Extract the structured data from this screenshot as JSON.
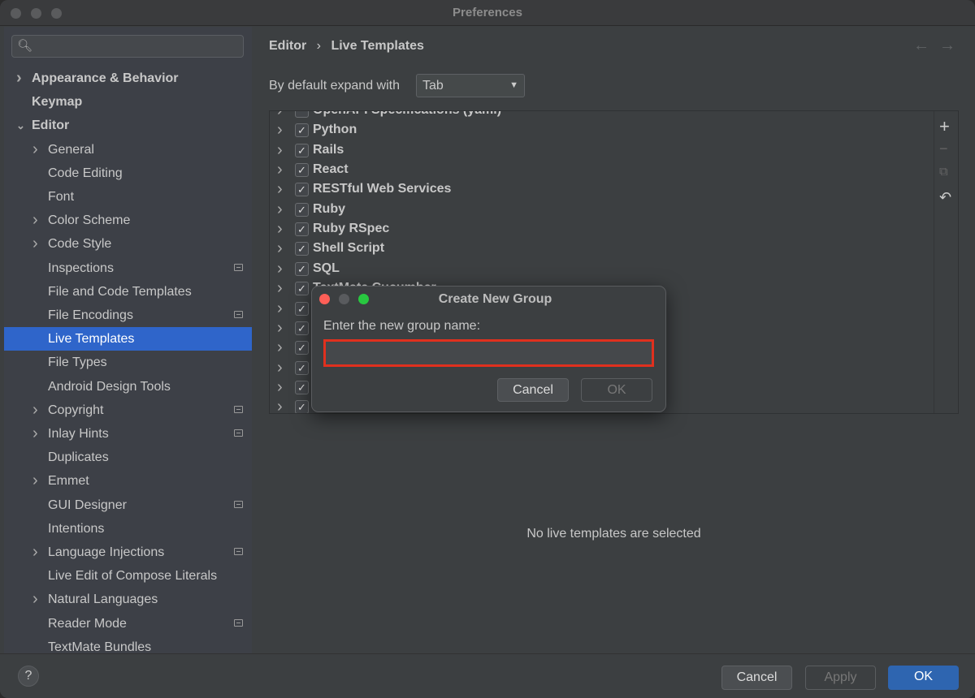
{
  "window": {
    "title": "Preferences"
  },
  "sidebar": {
    "search_placeholder": "",
    "items": [
      {
        "label": "Appearance & Behavior",
        "level": 0,
        "chevron": "right"
      },
      {
        "label": "Keymap",
        "level": 0,
        "chevron": ""
      },
      {
        "label": "Editor",
        "level": 0,
        "chevron": "down"
      },
      {
        "label": "General",
        "level": 1,
        "chevron": "right"
      },
      {
        "label": "Code Editing",
        "level": 1,
        "chevron": ""
      },
      {
        "label": "Font",
        "level": 1,
        "chevron": ""
      },
      {
        "label": "Color Scheme",
        "level": 1,
        "chevron": "right"
      },
      {
        "label": "Code Style",
        "level": 1,
        "chevron": "right"
      },
      {
        "label": "Inspections",
        "level": 1,
        "chevron": "",
        "badge": true
      },
      {
        "label": "File and Code Templates",
        "level": 1,
        "chevron": ""
      },
      {
        "label": "File Encodings",
        "level": 1,
        "chevron": "",
        "badge": true
      },
      {
        "label": "Live Templates",
        "level": 1,
        "chevron": "",
        "selected": true
      },
      {
        "label": "File Types",
        "level": 1,
        "chevron": ""
      },
      {
        "label": "Android Design Tools",
        "level": 1,
        "chevron": ""
      },
      {
        "label": "Copyright",
        "level": 1,
        "chevron": "right",
        "badge": true
      },
      {
        "label": "Inlay Hints",
        "level": 1,
        "chevron": "right",
        "badge": true
      },
      {
        "label": "Duplicates",
        "level": 1,
        "chevron": ""
      },
      {
        "label": "Emmet",
        "level": 1,
        "chevron": "right"
      },
      {
        "label": "GUI Designer",
        "level": 1,
        "chevron": "",
        "badge": true
      },
      {
        "label": "Intentions",
        "level": 1,
        "chevron": ""
      },
      {
        "label": "Language Injections",
        "level": 1,
        "chevron": "right",
        "badge": true
      },
      {
        "label": "Live Edit of Compose Literals",
        "level": 1,
        "chevron": ""
      },
      {
        "label": "Natural Languages",
        "level": 1,
        "chevron": "right"
      },
      {
        "label": "Reader Mode",
        "level": 1,
        "chevron": "",
        "badge": true
      },
      {
        "label": "TextMate Bundles",
        "level": 1,
        "chevron": ""
      }
    ]
  },
  "main": {
    "breadcrumb": [
      "Editor",
      "Live Templates"
    ],
    "expand_label": "By default expand with",
    "expand_value": "Tab",
    "templates": [
      {
        "label": "OpenAPI Specifications (yaml)",
        "checked": false
      },
      {
        "label": "Python",
        "checked": true
      },
      {
        "label": "Rails",
        "checked": true
      },
      {
        "label": "React",
        "checked": true
      },
      {
        "label": "RESTful Web Services",
        "checked": true
      },
      {
        "label": "Ruby",
        "checked": true
      },
      {
        "label": "Ruby RSpec",
        "checked": true
      },
      {
        "label": "Shell Script",
        "checked": true
      },
      {
        "label": "SQL",
        "checked": true
      },
      {
        "label": "TextMate Cucumber",
        "checked": true
      },
      {
        "label": "",
        "checked": true
      },
      {
        "label": "",
        "checked": true
      },
      {
        "label": "",
        "checked": true
      },
      {
        "label": "",
        "checked": true
      },
      {
        "label": "",
        "checked": true
      },
      {
        "label": "",
        "checked": true
      }
    ],
    "empty_text": "No live templates are selected"
  },
  "footer": {
    "help": "?",
    "cancel": "Cancel",
    "apply": "Apply",
    "ok": "OK",
    "ok_color": "#2e65b0"
  },
  "dialog": {
    "title": "Create New Group",
    "prompt": "Enter the new group name:",
    "value": "",
    "cancel": "Cancel",
    "ok": "OK",
    "highlight_color": "#e0301e"
  }
}
